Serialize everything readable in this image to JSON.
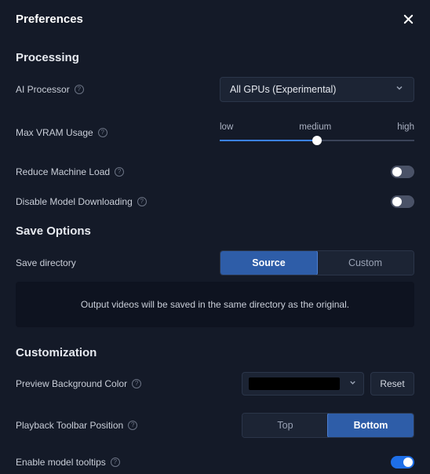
{
  "header": {
    "title": "Preferences"
  },
  "processing": {
    "title": "Processing",
    "ai_processor": {
      "label": "AI Processor",
      "value": "All GPUs (Experimental)"
    },
    "max_vram": {
      "label": "Max VRAM Usage",
      "low": "low",
      "medium": "medium",
      "high": "high"
    },
    "reduce_load": {
      "label": "Reduce Machine Load"
    },
    "disable_download": {
      "label": "Disable Model Downloading"
    }
  },
  "save": {
    "title": "Save Options",
    "directory": {
      "label": "Save directory",
      "source": "Source",
      "custom": "Custom"
    },
    "info": "Output videos will be saved in the same directory as the original."
  },
  "custom": {
    "title": "Customization",
    "bg_color": {
      "label": "Preview Background Color",
      "reset": "Reset"
    },
    "toolbar_pos": {
      "label": "Playback Toolbar Position",
      "top": "Top",
      "bottom": "Bottom"
    },
    "tooltips": {
      "label": "Enable model tooltips"
    }
  }
}
